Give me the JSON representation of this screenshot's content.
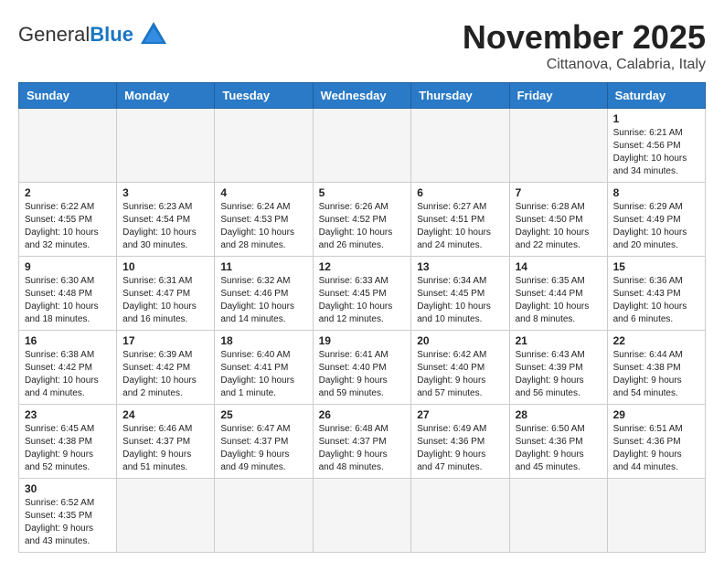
{
  "header": {
    "logo_general": "General",
    "logo_blue": "Blue",
    "month_title": "November 2025",
    "location": "Cittanova, Calabria, Italy"
  },
  "weekdays": [
    "Sunday",
    "Monday",
    "Tuesday",
    "Wednesday",
    "Thursday",
    "Friday",
    "Saturday"
  ],
  "weeks": [
    [
      {
        "day": "",
        "info": ""
      },
      {
        "day": "",
        "info": ""
      },
      {
        "day": "",
        "info": ""
      },
      {
        "day": "",
        "info": ""
      },
      {
        "day": "",
        "info": ""
      },
      {
        "day": "",
        "info": ""
      },
      {
        "day": "1",
        "info": "Sunrise: 6:21 AM\nSunset: 4:56 PM\nDaylight: 10 hours\nand 34 minutes."
      }
    ],
    [
      {
        "day": "2",
        "info": "Sunrise: 6:22 AM\nSunset: 4:55 PM\nDaylight: 10 hours\nand 32 minutes."
      },
      {
        "day": "3",
        "info": "Sunrise: 6:23 AM\nSunset: 4:54 PM\nDaylight: 10 hours\nand 30 minutes."
      },
      {
        "day": "4",
        "info": "Sunrise: 6:24 AM\nSunset: 4:53 PM\nDaylight: 10 hours\nand 28 minutes."
      },
      {
        "day": "5",
        "info": "Sunrise: 6:26 AM\nSunset: 4:52 PM\nDaylight: 10 hours\nand 26 minutes."
      },
      {
        "day": "6",
        "info": "Sunrise: 6:27 AM\nSunset: 4:51 PM\nDaylight: 10 hours\nand 24 minutes."
      },
      {
        "day": "7",
        "info": "Sunrise: 6:28 AM\nSunset: 4:50 PM\nDaylight: 10 hours\nand 22 minutes."
      },
      {
        "day": "8",
        "info": "Sunrise: 6:29 AM\nSunset: 4:49 PM\nDaylight: 10 hours\nand 20 minutes."
      }
    ],
    [
      {
        "day": "9",
        "info": "Sunrise: 6:30 AM\nSunset: 4:48 PM\nDaylight: 10 hours\nand 18 minutes."
      },
      {
        "day": "10",
        "info": "Sunrise: 6:31 AM\nSunset: 4:47 PM\nDaylight: 10 hours\nand 16 minutes."
      },
      {
        "day": "11",
        "info": "Sunrise: 6:32 AM\nSunset: 4:46 PM\nDaylight: 10 hours\nand 14 minutes."
      },
      {
        "day": "12",
        "info": "Sunrise: 6:33 AM\nSunset: 4:45 PM\nDaylight: 10 hours\nand 12 minutes."
      },
      {
        "day": "13",
        "info": "Sunrise: 6:34 AM\nSunset: 4:45 PM\nDaylight: 10 hours\nand 10 minutes."
      },
      {
        "day": "14",
        "info": "Sunrise: 6:35 AM\nSunset: 4:44 PM\nDaylight: 10 hours\nand 8 minutes."
      },
      {
        "day": "15",
        "info": "Sunrise: 6:36 AM\nSunset: 4:43 PM\nDaylight: 10 hours\nand 6 minutes."
      }
    ],
    [
      {
        "day": "16",
        "info": "Sunrise: 6:38 AM\nSunset: 4:42 PM\nDaylight: 10 hours\nand 4 minutes."
      },
      {
        "day": "17",
        "info": "Sunrise: 6:39 AM\nSunset: 4:42 PM\nDaylight: 10 hours\nand 2 minutes."
      },
      {
        "day": "18",
        "info": "Sunrise: 6:40 AM\nSunset: 4:41 PM\nDaylight: 10 hours\nand 1 minute."
      },
      {
        "day": "19",
        "info": "Sunrise: 6:41 AM\nSunset: 4:40 PM\nDaylight: 9 hours\nand 59 minutes."
      },
      {
        "day": "20",
        "info": "Sunrise: 6:42 AM\nSunset: 4:40 PM\nDaylight: 9 hours\nand 57 minutes."
      },
      {
        "day": "21",
        "info": "Sunrise: 6:43 AM\nSunset: 4:39 PM\nDaylight: 9 hours\nand 56 minutes."
      },
      {
        "day": "22",
        "info": "Sunrise: 6:44 AM\nSunset: 4:38 PM\nDaylight: 9 hours\nand 54 minutes."
      }
    ],
    [
      {
        "day": "23",
        "info": "Sunrise: 6:45 AM\nSunset: 4:38 PM\nDaylight: 9 hours\nand 52 minutes."
      },
      {
        "day": "24",
        "info": "Sunrise: 6:46 AM\nSunset: 4:37 PM\nDaylight: 9 hours\nand 51 minutes."
      },
      {
        "day": "25",
        "info": "Sunrise: 6:47 AM\nSunset: 4:37 PM\nDaylight: 9 hours\nand 49 minutes."
      },
      {
        "day": "26",
        "info": "Sunrise: 6:48 AM\nSunset: 4:37 PM\nDaylight: 9 hours\nand 48 minutes."
      },
      {
        "day": "27",
        "info": "Sunrise: 6:49 AM\nSunset: 4:36 PM\nDaylight: 9 hours\nand 47 minutes."
      },
      {
        "day": "28",
        "info": "Sunrise: 6:50 AM\nSunset: 4:36 PM\nDaylight: 9 hours\nand 45 minutes."
      },
      {
        "day": "29",
        "info": "Sunrise: 6:51 AM\nSunset: 4:36 PM\nDaylight: 9 hours\nand 44 minutes."
      }
    ],
    [
      {
        "day": "30",
        "info": "Sunrise: 6:52 AM\nSunset: 4:35 PM\nDaylight: 9 hours\nand 43 minutes."
      },
      {
        "day": "",
        "info": ""
      },
      {
        "day": "",
        "info": ""
      },
      {
        "day": "",
        "info": ""
      },
      {
        "day": "",
        "info": ""
      },
      {
        "day": "",
        "info": ""
      },
      {
        "day": "",
        "info": ""
      }
    ]
  ]
}
